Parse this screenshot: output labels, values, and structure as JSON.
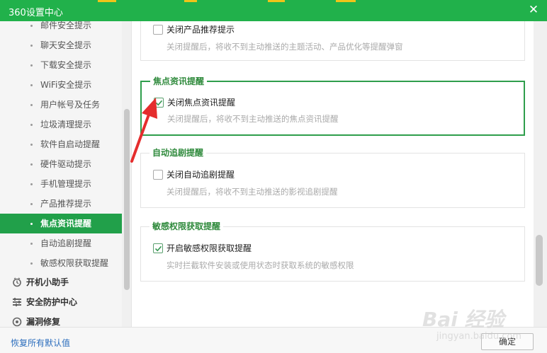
{
  "window": {
    "title": "360设置中心",
    "close_glyph": "✕"
  },
  "colors": {
    "brand_green": "#21b14b",
    "active_item": "#21a04a",
    "group_title": "#2f8a3c",
    "link_blue": "#2b6dbd"
  },
  "sidebar": {
    "sub_items": [
      {
        "label": "邮件安全提示",
        "active": false
      },
      {
        "label": "聊天安全提示",
        "active": false
      },
      {
        "label": "下载安全提示",
        "active": false
      },
      {
        "label": "WiFi安全提示",
        "active": false
      },
      {
        "label": "用户帐号及任务",
        "active": false
      },
      {
        "label": "垃圾清理提示",
        "active": false
      },
      {
        "label": "软件自启动提醒",
        "active": false
      },
      {
        "label": "硬件驱动提示",
        "active": false
      },
      {
        "label": "手机管理提示",
        "active": false
      },
      {
        "label": "产品推荐提示",
        "active": false
      },
      {
        "label": "焦点资讯提醒",
        "active": true
      },
      {
        "label": "自动追剧提醒",
        "active": false
      },
      {
        "label": "敏感权限获取提醒",
        "active": false
      }
    ],
    "categories": [
      {
        "label": "开机小助手",
        "icon": "startup-helper-icon"
      },
      {
        "label": "安全防护中心",
        "icon": "protection-center-icon"
      },
      {
        "label": "漏洞修复",
        "icon": "vulnerability-repair-icon"
      }
    ]
  },
  "content": {
    "top_option": {
      "label": "关闭产品推荐提示",
      "checked": false,
      "desc": "关闭提醒后，将收不到主动推送的主题活动、产品优化等提醒弹窗"
    },
    "groups": [
      {
        "title": "焦点资讯提醒",
        "option": "关闭焦点资讯提醒",
        "checked": true,
        "desc": "关闭提醒后，将收不到主动推送的焦点资讯提醒"
      },
      {
        "title": "自动追剧提醒",
        "option": "关闭自动追剧提醒",
        "checked": false,
        "desc": "关闭提醒后，将收不到主动推送的影视追剧提醒"
      },
      {
        "title": "敏感权限获取提醒",
        "option": "开启敏感权限获取提醒",
        "checked": true,
        "desc": "实时拦截软件安装或使用状态时获取系统的敏感权限"
      }
    ]
  },
  "footer": {
    "restore_label": "恢复所有默认值",
    "ok_label": "确定"
  },
  "watermark": {
    "main": "Bai 经验",
    "sub": "jingyan.baidu.com"
  }
}
